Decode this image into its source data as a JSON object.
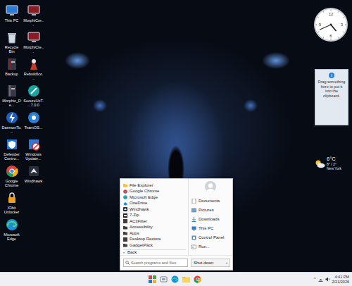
{
  "desktop": {
    "icons": [
      {
        "label": "This PC"
      },
      {
        "label": "Recycle Bin"
      },
      {
        "label": "Backup"
      },
      {
        "label": "Morphic_De..."
      },
      {
        "label": "DaemonTo..."
      },
      {
        "label": "Defender Contro..."
      },
      {
        "label": "Google Chrome"
      },
      {
        "label": "IObit Unlocker"
      },
      {
        "label": "Microsoft Edge"
      },
      {
        "label": "MorphiCre..."
      },
      {
        "label": "MorphiCre..."
      },
      {
        "label": "RebuildIco..."
      },
      {
        "label": "SecureUxT... 7.0.0"
      },
      {
        "label": "TeamOS..."
      },
      {
        "label": "Windows Update..."
      },
      {
        "label": "Windhawk"
      }
    ]
  },
  "gadgets": {
    "clock": {
      "numerals": [
        "12",
        "3",
        "6",
        "9"
      ],
      "hour": 4,
      "minute": 41
    },
    "clipboard": {
      "icon": "i",
      "text": "Drag something here to put it into the clipboard."
    },
    "weather": {
      "temperature": "6°C",
      "range": "8° / 2°",
      "location": "New York"
    }
  },
  "start_menu": {
    "programs": [
      {
        "label": "File Explorer"
      },
      {
        "label": "Google Chrome"
      },
      {
        "label": "Microsoft Edge"
      },
      {
        "label": "OneDrive"
      },
      {
        "label": "Windhawk"
      },
      {
        "label": "7-Zip"
      },
      {
        "label": "AC3Filter"
      },
      {
        "label": "Accessibility"
      },
      {
        "label": "Apps"
      },
      {
        "label": "Desktop Restore"
      },
      {
        "label": "GadgetPack"
      }
    ],
    "back": {
      "arrow": "‹",
      "label": "Back"
    },
    "places": [
      {
        "label": "Documents"
      },
      {
        "label": "Pictures"
      },
      {
        "label": "Downloads"
      },
      {
        "label": "This PC"
      },
      {
        "label": "Control Panel"
      },
      {
        "label": "Run..."
      }
    ],
    "search": {
      "placeholder": "Search programs and files"
    },
    "shutdown": {
      "label": "Shut down",
      "arrow": "›"
    }
  },
  "taskbar": {
    "tray": {
      "chevron": "^",
      "time": "4:41 PM",
      "date": "2/21/2026"
    }
  }
}
